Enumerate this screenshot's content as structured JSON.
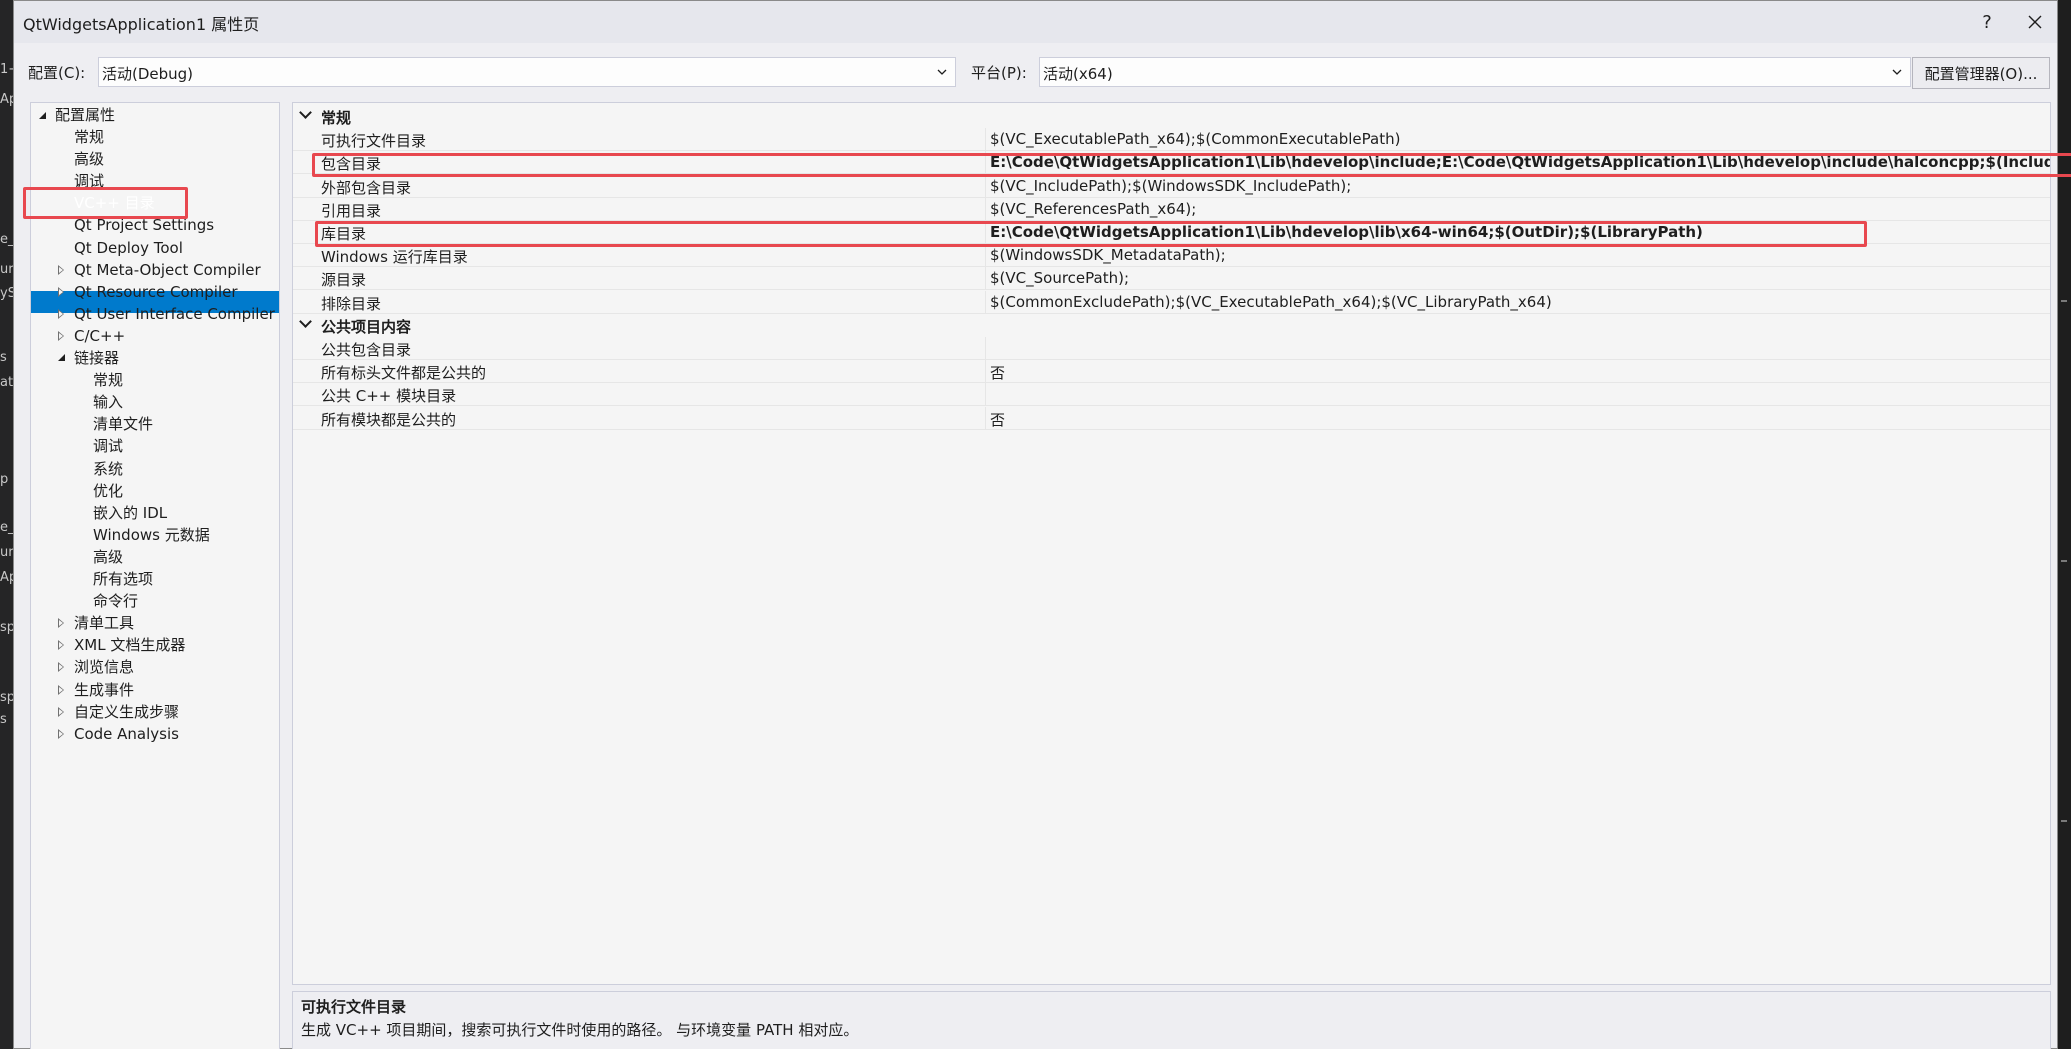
{
  "window": {
    "title": "QtWidgetsApplication1 属性页",
    "help_label": "?",
    "close_label": "✕"
  },
  "config": {
    "config_label": "配置(C):",
    "config_value": "活动(Debug)",
    "platform_label": "平台(P):",
    "platform_value": "活动(x64)",
    "manager_label": "配置管理器(O)..."
  },
  "tree": {
    "root": "配置属性",
    "items": [
      {
        "label": "常规",
        "level": 1,
        "exp": "none"
      },
      {
        "label": "高级",
        "level": 1,
        "exp": "none"
      },
      {
        "label": "调试",
        "level": 1,
        "exp": "none"
      },
      {
        "label": "VC++ 目录",
        "level": 1,
        "exp": "none",
        "selected": true
      },
      {
        "label": "Qt Project Settings",
        "level": 1,
        "exp": "none"
      },
      {
        "label": "Qt Deploy Tool",
        "level": 1,
        "exp": "none"
      },
      {
        "label": "Qt Meta-Object Compiler",
        "level": 1,
        "exp": "collapsed"
      },
      {
        "label": "Qt Resource Compiler",
        "level": 1,
        "exp": "collapsed"
      },
      {
        "label": "Qt User Interface Compiler",
        "level": 1,
        "exp": "collapsed"
      },
      {
        "label": "C/C++",
        "level": 1,
        "exp": "collapsed"
      },
      {
        "label": "链接器",
        "level": 1,
        "exp": "expanded"
      },
      {
        "label": "常规",
        "level": 2,
        "exp": "none"
      },
      {
        "label": "输入",
        "level": 2,
        "exp": "none"
      },
      {
        "label": "清单文件",
        "level": 2,
        "exp": "none"
      },
      {
        "label": "调试",
        "level": 2,
        "exp": "none"
      },
      {
        "label": "系统",
        "level": 2,
        "exp": "none"
      },
      {
        "label": "优化",
        "level": 2,
        "exp": "none"
      },
      {
        "label": "嵌入的 IDL",
        "level": 2,
        "exp": "none"
      },
      {
        "label": "Windows 元数据",
        "level": 2,
        "exp": "none"
      },
      {
        "label": "高级",
        "level": 2,
        "exp": "none"
      },
      {
        "label": "所有选项",
        "level": 2,
        "exp": "none"
      },
      {
        "label": "命令行",
        "level": 2,
        "exp": "none"
      },
      {
        "label": "清单工具",
        "level": 1,
        "exp": "collapsed"
      },
      {
        "label": "XML 文档生成器",
        "level": 1,
        "exp": "collapsed"
      },
      {
        "label": "浏览信息",
        "level": 1,
        "exp": "collapsed"
      },
      {
        "label": "生成事件",
        "level": 1,
        "exp": "collapsed"
      },
      {
        "label": "自定义生成步骤",
        "level": 1,
        "exp": "collapsed"
      },
      {
        "label": "Code Analysis",
        "level": 1,
        "exp": "collapsed"
      }
    ]
  },
  "grid": {
    "categories": [
      {
        "name": "常规",
        "rows": [
          {
            "name": "可执行文件目录",
            "value": "$(VC_ExecutablePath_x64);$(CommonExecutablePath)",
            "bold": false
          },
          {
            "name": "包含目录",
            "value": "E:\\Code\\QtWidgetsApplication1\\Lib\\hdevelop\\include;E:\\Code\\QtWidgetsApplication1\\Lib\\hdevelop\\include\\halconcpp;$(IncludePath)",
            "bold": true
          },
          {
            "name": "外部包含目录",
            "value": "$(VC_IncludePath);$(WindowsSDK_IncludePath);",
            "bold": false
          },
          {
            "name": "引用目录",
            "value": "$(VC_ReferencesPath_x64);",
            "bold": false
          },
          {
            "name": "库目录",
            "value": "E:\\Code\\QtWidgetsApplication1\\Lib\\hdevelop\\lib\\x64-win64;$(OutDir);$(LibraryPath)",
            "bold": true
          },
          {
            "name": "Windows 运行库目录",
            "value": "$(WindowsSDK_MetadataPath);",
            "bold": false
          },
          {
            "name": "源目录",
            "value": "$(VC_SourcePath);",
            "bold": false
          },
          {
            "name": "排除目录",
            "value": "$(CommonExcludePath);$(VC_ExecutablePath_x64);$(VC_LibraryPath_x64)",
            "bold": false
          }
        ]
      },
      {
        "name": "公共项目内容",
        "rows": [
          {
            "name": "公共包含目录",
            "value": "",
            "bold": false
          },
          {
            "name": "所有标头文件都是公共的",
            "value": "否",
            "bold": false
          },
          {
            "name": "公共 C++ 模块目录",
            "value": "",
            "bold": false
          },
          {
            "name": "所有模块都是公共的",
            "value": "否",
            "bold": false
          }
        ]
      }
    ]
  },
  "description": {
    "title": "可执行文件目录",
    "text": "生成 VC++ 项目期间，搜索可执行文件时使用的路径。 与环境变量 PATH 相对应。"
  },
  "ide_fragments": [
    "1+",
    "Ap",
    "e_",
    "ury",
    "yS",
    "s",
    "ati",
    "p",
    "e_",
    "ury",
    "Ap",
    "sp",
    "sp",
    "s"
  ],
  "colors": {
    "selection": "#007acc",
    "highlight_box": "#e8484f",
    "dialog_bg": "#eeeef2"
  }
}
